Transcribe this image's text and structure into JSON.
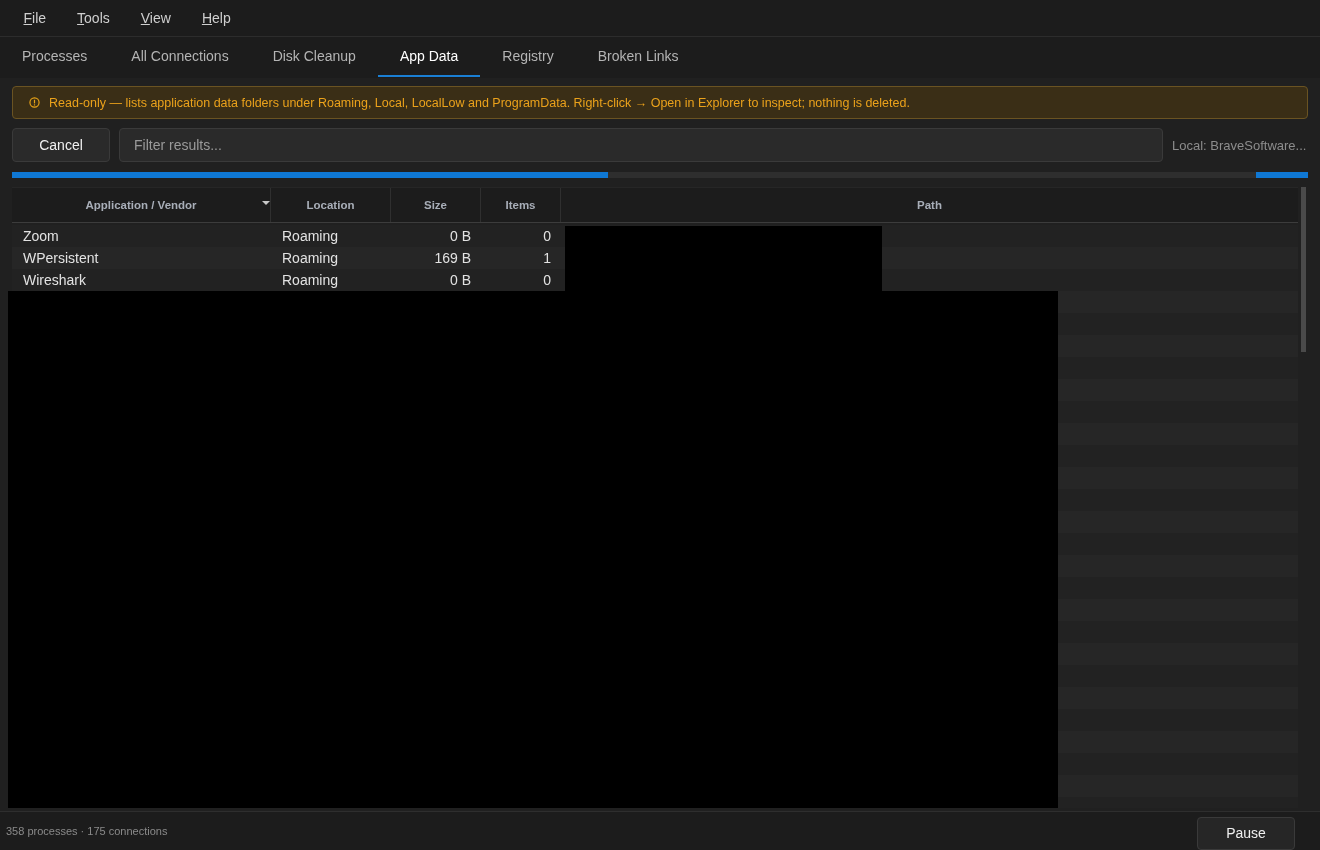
{
  "menu": [
    {
      "label": "File"
    },
    {
      "label": "Tools"
    },
    {
      "label": "View"
    },
    {
      "label": "Help"
    }
  ],
  "tabs": [
    {
      "label": "Processes",
      "selected": false
    },
    {
      "label": "All Connections",
      "selected": false
    },
    {
      "label": "Disk Cleanup",
      "selected": false
    },
    {
      "label": "App Data",
      "selected": true
    },
    {
      "label": "Registry",
      "selected": false
    },
    {
      "label": "Broken Links",
      "selected": false
    }
  ],
  "notice": {
    "text": "Read-only — lists application data folders under Roaming, Local, LocalLow and ProgramData. Right-click → Open in Explorer to inspect; nothing is deleted."
  },
  "toolbar": {
    "cancel_button": "Cancel",
    "filter": {
      "placeholder": "Filter results..."
    },
    "current_item": "Local: BraveSoftware..."
  },
  "progress": {
    "fills": [
      {
        "level": 0.46
      },
      {
        "level": 0.04
      }
    ]
  },
  "table": {
    "columns": [
      {
        "label": "Application / Vendor",
        "sorted": true
      },
      {
        "label": "Location",
        "sorted": false
      },
      {
        "label": "Size",
        "sorted": false
      },
      {
        "label": "Items",
        "sorted": false
      },
      {
        "label": "Path",
        "sorted": false
      }
    ],
    "rows": [
      {
        "cells": [
          "Zoom",
          "Roaming",
          "0 B",
          "0"
        ]
      },
      {
        "cells": [
          "WPersistent",
          "Roaming",
          "169 B",
          "1"
        ]
      },
      {
        "cells": [
          "Wireshark",
          "Roaming",
          "0 B",
          "0"
        ]
      }
    ]
  },
  "status_bar": {
    "text": "358 processes · 175 connections",
    "pause_button": "Pause"
  }
}
